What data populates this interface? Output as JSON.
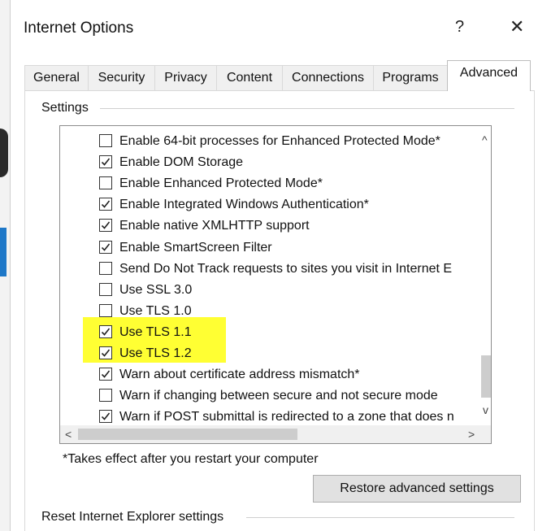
{
  "window": {
    "title": "Internet Options",
    "help_glyph": "?",
    "close_glyph": "✕"
  },
  "tabs": [
    {
      "label": "General",
      "active": false
    },
    {
      "label": "Security",
      "active": false
    },
    {
      "label": "Privacy",
      "active": false
    },
    {
      "label": "Content",
      "active": false
    },
    {
      "label": "Connections",
      "active": false
    },
    {
      "label": "Programs",
      "active": false
    },
    {
      "label": "Advanced",
      "active": true
    }
  ],
  "settings": {
    "group_label": "Settings",
    "options": [
      {
        "label": "Enable 64-bit processes for Enhanced Protected Mode*",
        "checked": false
      },
      {
        "label": "Enable DOM Storage",
        "checked": true
      },
      {
        "label": "Enable Enhanced Protected Mode*",
        "checked": false
      },
      {
        "label": "Enable Integrated Windows Authentication*",
        "checked": true
      },
      {
        "label": "Enable native XMLHTTP support",
        "checked": true
      },
      {
        "label": "Enable SmartScreen Filter",
        "checked": true
      },
      {
        "label": "Send Do Not Track requests to sites you visit in Internet E",
        "checked": false
      },
      {
        "label": "Use SSL 3.0",
        "checked": false
      },
      {
        "label": "Use TLS 1.0",
        "checked": false
      },
      {
        "label": "Use TLS 1.1",
        "checked": true,
        "highlighted": true
      },
      {
        "label": "Use TLS 1.2",
        "checked": true,
        "highlighted": true
      },
      {
        "label": "Warn about certificate address mismatch*",
        "checked": true
      },
      {
        "label": "Warn if changing between secure and not secure mode",
        "checked": false
      },
      {
        "label": "Warn if POST submittal is redirected to a zone that does n",
        "checked": true
      }
    ],
    "scroll_up_glyph": "^",
    "scroll_down_glyph": "v",
    "scroll_left_glyph": "<",
    "scroll_right_glyph": ">",
    "footnote": "*Takes effect after you restart your computer",
    "restore_button": "Restore advanced settings"
  },
  "reset_section": {
    "group_label": "Reset Internet Explorer settings"
  },
  "colors": {
    "highlight": "#ffff33",
    "checkmark": "#222222"
  }
}
